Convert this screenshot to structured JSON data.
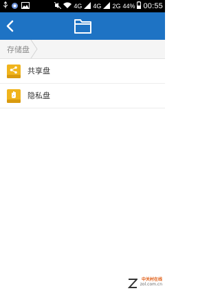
{
  "status_bar": {
    "network_1": "4G",
    "network_2": "4G",
    "network_3": "2G",
    "battery": "44%",
    "time": "00:55"
  },
  "breadcrumb": {
    "root_label": "存储盘"
  },
  "items": [
    {
      "label": "共享盘",
      "icon": "share-drive-icon"
    },
    {
      "label": "隐私盘",
      "icon": "private-drive-icon"
    }
  ],
  "watermark": {
    "cn": "中关村在线",
    "url": "zol.com.cn"
  },
  "colors": {
    "app_bar": "#1e73c4",
    "drive_icon": "#f0b41c"
  }
}
